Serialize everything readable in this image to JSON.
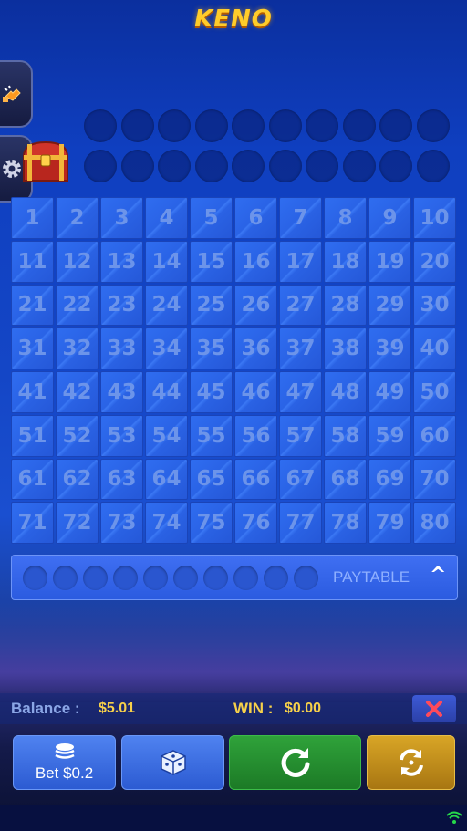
{
  "header": {
    "title": "KENO",
    "title_color": "#ffcc2a"
  },
  "side_buttons": [
    {
      "icon": "hand-click-icon"
    },
    {
      "icon": "gear-icon"
    }
  ],
  "treasure": {
    "icon": "treasure-chest-icon"
  },
  "drawn_slots": {
    "count": 20
  },
  "board": {
    "numbers": [
      "1",
      "2",
      "3",
      "4",
      "5",
      "6",
      "7",
      "8",
      "9",
      "10",
      "11",
      "12",
      "13",
      "14",
      "15",
      "16",
      "17",
      "18",
      "19",
      "20",
      "21",
      "22",
      "23",
      "24",
      "25",
      "26",
      "27",
      "28",
      "29",
      "30",
      "31",
      "32",
      "33",
      "34",
      "35",
      "36",
      "37",
      "38",
      "39",
      "40",
      "41",
      "42",
      "43",
      "44",
      "45",
      "46",
      "47",
      "48",
      "49",
      "50",
      "51",
      "52",
      "53",
      "54",
      "55",
      "56",
      "57",
      "58",
      "59",
      "60",
      "61",
      "62",
      "63",
      "64",
      "65",
      "66",
      "67",
      "68",
      "69",
      "70",
      "71",
      "72",
      "73",
      "74",
      "75",
      "76",
      "77",
      "78",
      "79",
      "80"
    ]
  },
  "paytable": {
    "label": "PAYTABLE",
    "slot_count": 10,
    "chevron": "^"
  },
  "status": {
    "balance_label": "Balance : ",
    "balance_value": "$5.01",
    "win_label": "WIN : ",
    "win_value": "$0.00",
    "close_icon": "close-icon"
  },
  "controls": {
    "bet_label": "Bet $0.2",
    "bet_icon": "chip-stack-icon",
    "random_icon": "dice-icon",
    "play_icon": "refresh-play-icon",
    "auto_icon": "autoplay-icon"
  },
  "colors": {
    "accent_green": "#1f8a2b",
    "accent_gold": "#c08f1e",
    "board_blue": "#2a63e6"
  }
}
